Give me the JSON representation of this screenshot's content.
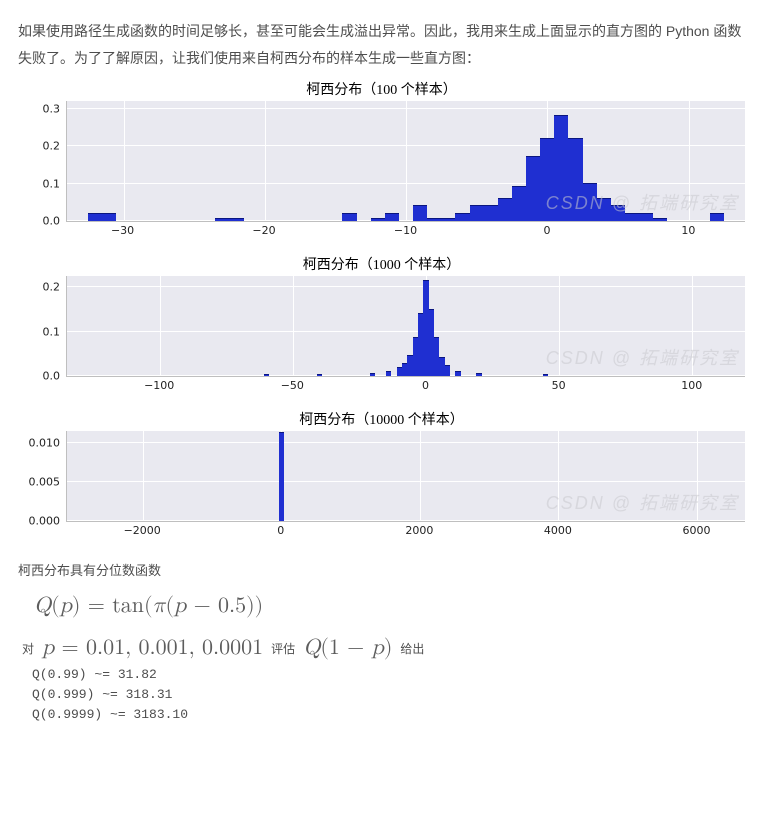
{
  "intro": "如果使用路径生成函数的时间足够长，甚至可能会生成溢出异常。因此，我用来生成上面显示的直方图的 Python 函数失败了。为了了解原因，让我们使用来自柯西分布的样本生成一些直方图：",
  "section_quantile": "柯西分布具有分位数函数",
  "formula_Q": "Q(p) = tan(π(p − 0.5))",
  "p_prefix": "对",
  "formula_p": "p = 0.01, 0.001, 0.0001",
  "p_mid": "评估",
  "formula_Q1mp": "Q(1 − p)",
  "p_suffix": "给出",
  "q_lines": [
    "Q(0.99)  ~= 31.82",
    "Q(0.999)  ~= 318.31",
    "Q(0.9999)  ~= 3183.10"
  ],
  "watermark": "CSDN @ 拓端研究室",
  "chart_data": [
    {
      "type": "bar-hist",
      "title": "柯西分布（100 个样本）",
      "xticks": [
        -30,
        -20,
        -10,
        0,
        10
      ],
      "xlim": [
        -34,
        14
      ],
      "yticks": [
        0.0,
        0.1,
        0.2,
        0.3
      ],
      "ylim": [
        0,
        0.32
      ],
      "bins": [
        {
          "x": -32,
          "h": 0.02
        },
        {
          "x": -31,
          "h": 0.02
        },
        {
          "x": -23,
          "h": 0.005
        },
        {
          "x": -22,
          "h": 0.005
        },
        {
          "x": -14,
          "h": 0.02
        },
        {
          "x": -12,
          "h": 0.005
        },
        {
          "x": -11,
          "h": 0.02
        },
        {
          "x": -9,
          "h": 0.04
        },
        {
          "x": -8,
          "h": 0.005
        },
        {
          "x": -7,
          "h": 0.005
        },
        {
          "x": -6,
          "h": 0.02
        },
        {
          "x": -5,
          "h": 0.04
        },
        {
          "x": -4,
          "h": 0.04
        },
        {
          "x": -3,
          "h": 0.06
        },
        {
          "x": -2,
          "h": 0.09
        },
        {
          "x": -1,
          "h": 0.17
        },
        {
          "x": 0,
          "h": 0.22
        },
        {
          "x": 1,
          "h": 0.28
        },
        {
          "x": 2,
          "h": 0.22
        },
        {
          "x": 3,
          "h": 0.1
        },
        {
          "x": 4,
          "h": 0.06
        },
        {
          "x": 5,
          "h": 0.04
        },
        {
          "x": 6,
          "h": 0.02
        },
        {
          "x": 7,
          "h": 0.02
        },
        {
          "x": 8,
          "h": 0.005
        },
        {
          "x": 12,
          "h": 0.02
        }
      ]
    },
    {
      "type": "bar-hist",
      "title": "柯西分布（1000 个样本）",
      "xticks": [
        -100,
        -50,
        0,
        50,
        100
      ],
      "xlim": [
        -135,
        120
      ],
      "yticks": [
        0.0,
        0.1,
        0.2
      ],
      "ylim": [
        0,
        0.225
      ],
      "bins": [
        {
          "x": -60,
          "h": 0.002
        },
        {
          "x": -40,
          "h": 0.003
        },
        {
          "x": -20,
          "h": 0.006
        },
        {
          "x": -14,
          "h": 0.01
        },
        {
          "x": -10,
          "h": 0.018
        },
        {
          "x": -8,
          "h": 0.028
        },
        {
          "x": -6,
          "h": 0.045
        },
        {
          "x": -4,
          "h": 0.085
        },
        {
          "x": -2,
          "h": 0.14
        },
        {
          "x": 0,
          "h": 0.215
        },
        {
          "x": 2,
          "h": 0.15
        },
        {
          "x": 4,
          "h": 0.085
        },
        {
          "x": 6,
          "h": 0.04
        },
        {
          "x": 8,
          "h": 0.022
        },
        {
          "x": 12,
          "h": 0.01
        },
        {
          "x": 20,
          "h": 0.005
        },
        {
          "x": 45,
          "h": 0.002
        }
      ]
    },
    {
      "type": "bar-hist",
      "title": "柯西分布（10000 个样本）",
      "xticks": [
        -2000,
        0,
        2000,
        4000,
        6000
      ],
      "xlim": [
        -3100,
        6700
      ],
      "yticks": [
        0.0,
        0.005,
        0.01
      ],
      "ylim": [
        0,
        0.0115
      ],
      "bins": [
        {
          "x": 0,
          "h": 0.0113
        }
      ]
    }
  ]
}
